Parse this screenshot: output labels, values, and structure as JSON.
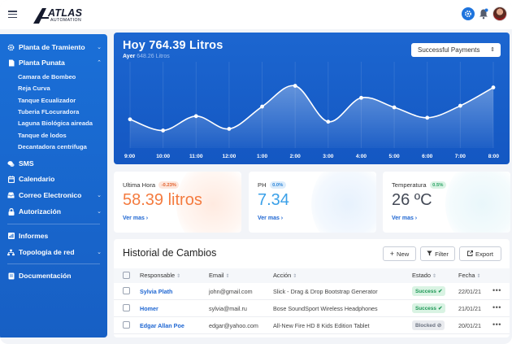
{
  "brand": {
    "name": "ATLAS",
    "tagline": "AUTOMATION"
  },
  "header": {
    "icons": [
      "menu-icon",
      "gear-icon",
      "bell-icon",
      "user-avatar"
    ]
  },
  "sidebar": {
    "items": [
      {
        "label": "Planta de Tramiento",
        "icon": "cog-icon",
        "chevron": "⌄"
      },
      {
        "label": "Planta Punata",
        "icon": "document-icon",
        "chevron": "⌃"
      },
      {
        "label": "SMS",
        "icon": "chat-icon"
      },
      {
        "label": "Calendario",
        "icon": "calendar-icon"
      },
      {
        "label": "Correo Electronico",
        "icon": "inbox-icon",
        "chevron": "⌄"
      },
      {
        "label": "Autorización",
        "icon": "lock-icon",
        "chevron": "⌄"
      },
      {
        "label": "Informes",
        "icon": "chart-icon"
      },
      {
        "label": "Topologia de red",
        "icon": "network-icon",
        "chevron": "⌄"
      },
      {
        "label": "Documentación",
        "icon": "doc-icon"
      }
    ],
    "subitems": [
      "Camara de Bombeo",
      "Reja Curva",
      "Tanque Ecualizador",
      "Tuberia FLocuradora",
      "Laguna Biológica aireada",
      "Tanque de lodos",
      "Decantadora centrifuga"
    ]
  },
  "hero": {
    "title": "Hoy 764.39 Litros",
    "sub_label": "Ayer",
    "sub_value": "648.26 Litros",
    "select_label": "Successful Payments",
    "select_caret": "⇕"
  },
  "chart_data": {
    "type": "area",
    "x": [
      "9:00",
      "10:00",
      "11:00",
      "12:00",
      "1:00",
      "2:00",
      "3:00",
      "4:00",
      "5:00",
      "6:00",
      "7:00",
      "8:00"
    ],
    "series": [
      {
        "values": [
          36,
          22,
          40,
          24,
          52,
          78,
          33,
          63,
          51,
          38,
          53,
          76
        ]
      }
    ],
    "ylim": [
      0,
      100
    ],
    "grid": true,
    "line_color": "#ffffff"
  },
  "stats": [
    {
      "label": "Ultima Hora",
      "badge": "-0.23%",
      "value": "58.39 litros",
      "link": "Ver mas ›",
      "value_color": "#f47b3f",
      "badge_bg": "#fde6dc",
      "badge_fg": "#e2622f",
      "blob": "#ffd9c7"
    },
    {
      "label": "PH",
      "badge": "0.0%",
      "value": "7.34",
      "link": "Ver mas ›",
      "value_color": "#3aa0e8",
      "badge_bg": "#dcecfb",
      "badge_fg": "#2d86d8",
      "blob": "#d3e6fb"
    },
    {
      "label": "Temperatura",
      "badge": "0.5%",
      "value": "26 ºC",
      "link": "Ver mas ›",
      "value_color": "#444a57",
      "badge_bg": "#daf3e4",
      "badge_fg": "#2ba365",
      "blob": "#d7f0f7"
    }
  ],
  "table": {
    "title": "Historial de Cambios",
    "buttons": {
      "new": "New",
      "filter": "Filter",
      "export": "Export"
    },
    "headers": [
      "Responsable",
      "Email",
      "Acción",
      "Estado",
      "Fecha"
    ],
    "sort_glyph": "⇕",
    "rows": [
      {
        "name": "Sylvia Plath",
        "email": "john@gmail.com",
        "action": "Slick - Drag & Drop Bootstrap Generator",
        "status": "Success",
        "status_icon": "✔",
        "date": "22/01/21"
      },
      {
        "name": "Homer",
        "email": "sylvia@mail.ru",
        "action": "Bose SoundSport Wireless Headphones",
        "status": "Success",
        "status_icon": "✔",
        "date": "21/01/21"
      },
      {
        "name": "Edgar Allan Poe",
        "email": "edgar@yahoo.com",
        "action": "All-New Fire HD 8 Kids Edition Tablet",
        "status": "Blocked",
        "status_icon": "⊘",
        "date": "20/01/21"
      }
    ],
    "more": "•••"
  }
}
